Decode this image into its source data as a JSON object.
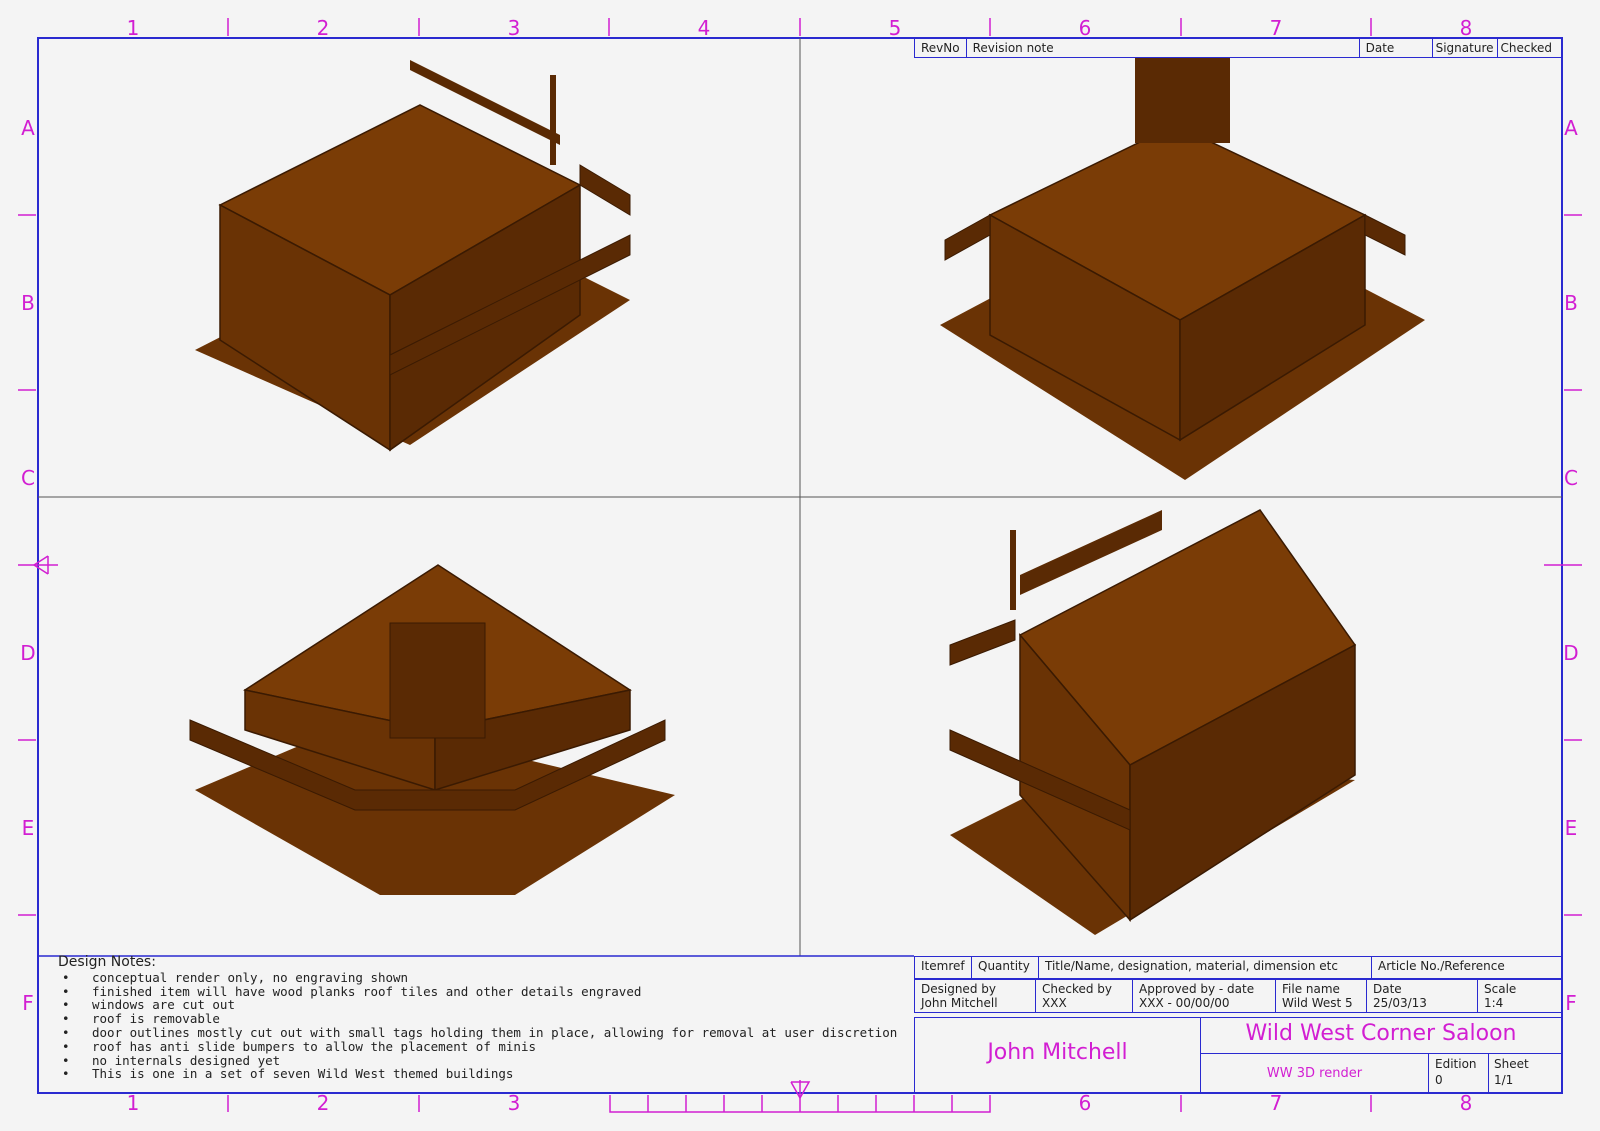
{
  "zones": {
    "columns": [
      "1",
      "2",
      "3",
      "4",
      "5",
      "6",
      "7",
      "8"
    ],
    "rows": [
      "A",
      "B",
      "C",
      "D",
      "E",
      "F"
    ]
  },
  "revision_table": {
    "headers": [
      "RevNo",
      "Revision note",
      "Date",
      "Signature",
      "Checked"
    ]
  },
  "design_notes": {
    "heading": "Design Notes:",
    "items": [
      "conceptual render only, no engraving shown",
      "finished item will have wood planks roof tiles and other details engraved",
      "windows are cut out",
      "roof is removable",
      "door outlines mostly cut out with small tags holding them in place, allowing for removal at user discretion",
      "roof has anti slide bumpers to allow the placement of minis",
      "no internals designed yet",
      "This is one in a set of seven Wild West themed buildings"
    ]
  },
  "title_block": {
    "headers": {
      "itemref": "Itemref",
      "quantity": "Quantity",
      "title": "Title/Name, designation, material, dimension etc",
      "article": "Article No./Reference"
    },
    "designed_by": {
      "label": "Designed by",
      "value": "John Mitchell"
    },
    "checked_by": {
      "label": "Checked by",
      "value": "XXX"
    },
    "approved_by": {
      "label": "Approved by - date",
      "value": "XXX - 00/00/00"
    },
    "file_name": {
      "label": "File name",
      "value": "Wild West 5"
    },
    "date": {
      "label": "Date",
      "value": "25/03/13"
    },
    "scale": {
      "label": "Scale",
      "value": "1:4"
    },
    "author": "John Mitchell",
    "title": "Wild West Corner Saloon",
    "subtitle": "WW 3D render",
    "edition": {
      "label": "Edition",
      "value": "0"
    },
    "sheet": {
      "label": "Sheet",
      "value": "1/1"
    }
  },
  "colors": {
    "zone_text": "#d21ed2",
    "frame": "#2a2ad0",
    "wood_top": "#7a3c06",
    "wood_left": "#6a3305",
    "wood_right": "#5a2a04",
    "wood_edge": "#3a1a02"
  }
}
